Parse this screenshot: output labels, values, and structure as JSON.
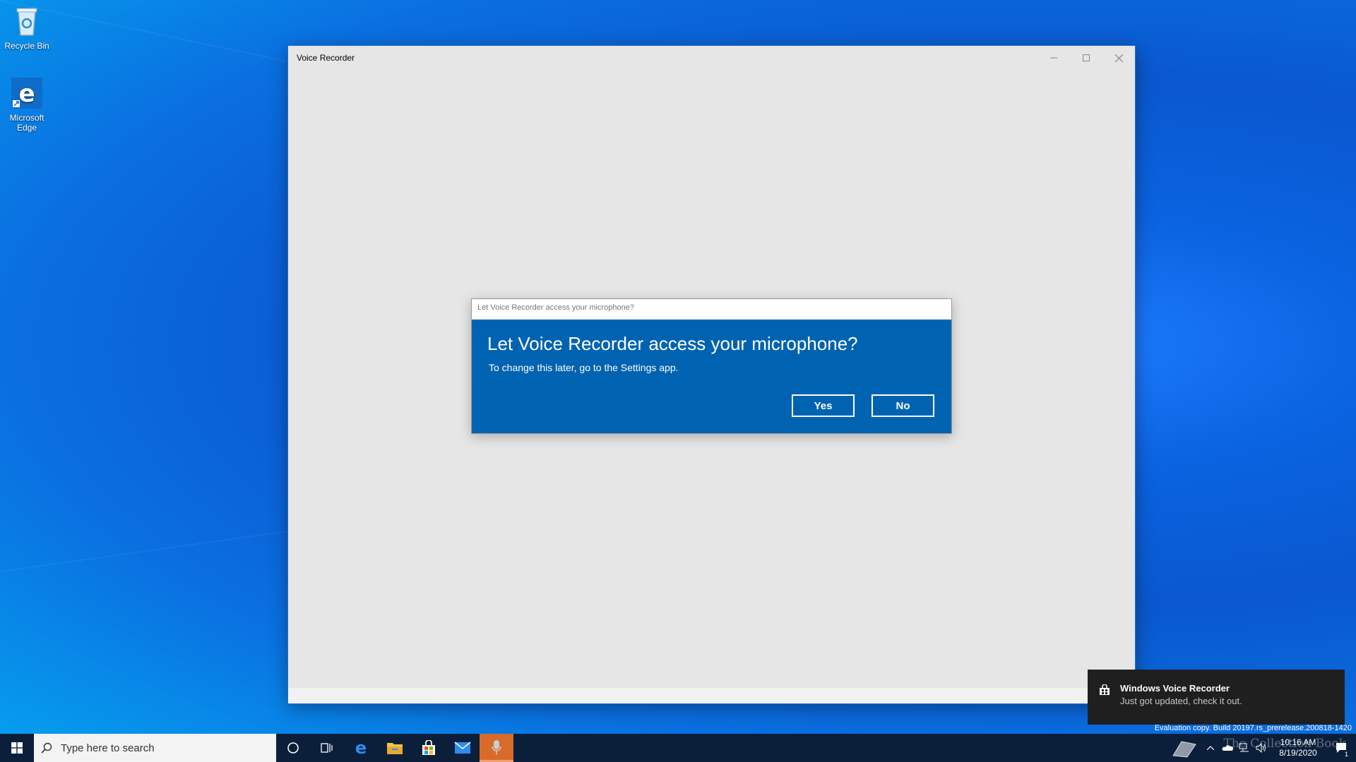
{
  "desktop": {
    "icons": [
      {
        "label": "Recycle Bin"
      },
      {
        "label": "Microsoft Edge"
      }
    ]
  },
  "window": {
    "title": "Voice Recorder",
    "minimize_icon": "minimize-icon",
    "maximize_icon": "maximize-icon",
    "close_icon": "close-icon"
  },
  "dialog": {
    "caption": "Let Voice Recorder access your microphone?",
    "heading": "Let Voice Recorder access your microphone?",
    "message": "To change this later, go to the Settings app.",
    "yes_label": "Yes",
    "no_label": "No",
    "bg_color": "#0063b1"
  },
  "toast": {
    "title": "Windows Voice Recorder",
    "message": "Just got updated, check it out."
  },
  "system": {
    "eval_text": "Evaluation copy. Build 20197.rs_prerelease.200818-1420",
    "time": "10:16 AM",
    "date": "8/19/2020",
    "notification_count": "1",
    "watermark": "The Collection Book"
  },
  "taskbar": {
    "search_placeholder": "Type here to search",
    "pinned": [
      "cortana-icon",
      "task-view-icon",
      "edge-icon",
      "file-explorer-icon",
      "store-icon",
      "mail-icon",
      "voice-recorder-icon"
    ]
  }
}
